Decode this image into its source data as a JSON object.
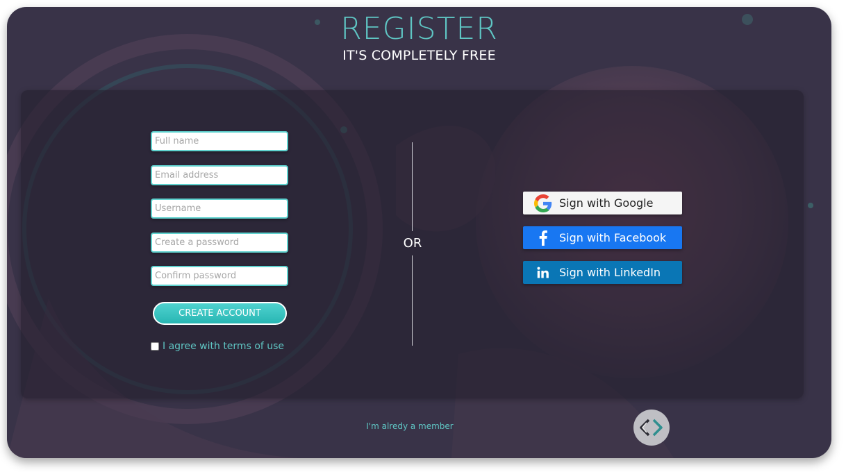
{
  "header": {
    "title": "REGISTER",
    "subtitle": "IT'S COMPLETELY FREE"
  },
  "form": {
    "full_name": {
      "placeholder": "Full name",
      "value": ""
    },
    "email": {
      "placeholder": "Email address",
      "value": ""
    },
    "username": {
      "placeholder": "Username",
      "value": ""
    },
    "password": {
      "placeholder": "Create a password",
      "value": ""
    },
    "confirm_password": {
      "placeholder": "Confirm password",
      "value": ""
    },
    "create_button_label": "CREATE ACCOUNT",
    "terms_label": "I agree with terms of use",
    "terms_checked": false
  },
  "divider_label": "OR",
  "social": {
    "google_label": "Sign with Google",
    "facebook_label": "Sign with Facebook",
    "linkedin_label": "Sign with LinkedIn",
    "icons": [
      "google-icon",
      "facebook-icon",
      "linkedin-icon"
    ]
  },
  "footer": {
    "member_link": "I'm alredy a member",
    "logo_icon": "code-brackets-icon"
  },
  "colors": {
    "accent": "#5fc6c4",
    "background": "#393348",
    "facebook": "#1877f2",
    "linkedin": "#0a76b5"
  }
}
